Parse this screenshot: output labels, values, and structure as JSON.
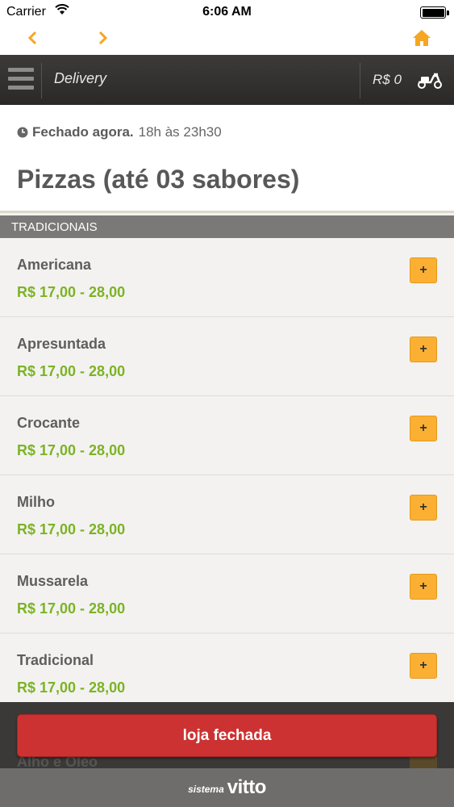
{
  "statusbar": {
    "carrier": "Carrier",
    "time": "6:06 AM"
  },
  "navbar": {
    "accent_color": "#f5a623",
    "icons": [
      "chevron-left-icon",
      "chevron-right-icon",
      "home-icon"
    ]
  },
  "header": {
    "title": "Delivery",
    "cart_total": "R$ 0",
    "icons": [
      "menu-icon",
      "scooter-icon"
    ]
  },
  "store": {
    "status_label": "Fechado agora.",
    "hours": "18h às 23h30",
    "category_title": "Pizzas (até 03 sabores)",
    "icons": [
      "clock-icon"
    ]
  },
  "section": {
    "title": "TRADICIONAIS"
  },
  "items": [
    {
      "name": "Americana",
      "price": "R$ 17,00 - 28,00",
      "add_label": "+"
    },
    {
      "name": "Apresuntada",
      "price": "R$ 17,00 - 28,00",
      "add_label": "+"
    },
    {
      "name": "Crocante",
      "price": "R$ 17,00 - 28,00",
      "add_label": "+"
    },
    {
      "name": "Milho",
      "price": "R$ 17,00 - 28,00",
      "add_label": "+"
    },
    {
      "name": "Mussarela",
      "price": "R$ 17,00 - 28,00",
      "add_label": "+"
    },
    {
      "name": "Tradicional",
      "price": "R$ 17,00 - 28,00",
      "add_label": "+"
    }
  ],
  "partially_hidden_item": {
    "name": "Alho e Óleo"
  },
  "closed_button": {
    "label": "loja fechada",
    "color": "#cc3232"
  },
  "footer": {
    "prefix": "sistema",
    "brand": "vitto"
  },
  "colors": {
    "price": "#7cb324",
    "add_button": "#fbb034",
    "header_bg": "#2f2e2d"
  }
}
